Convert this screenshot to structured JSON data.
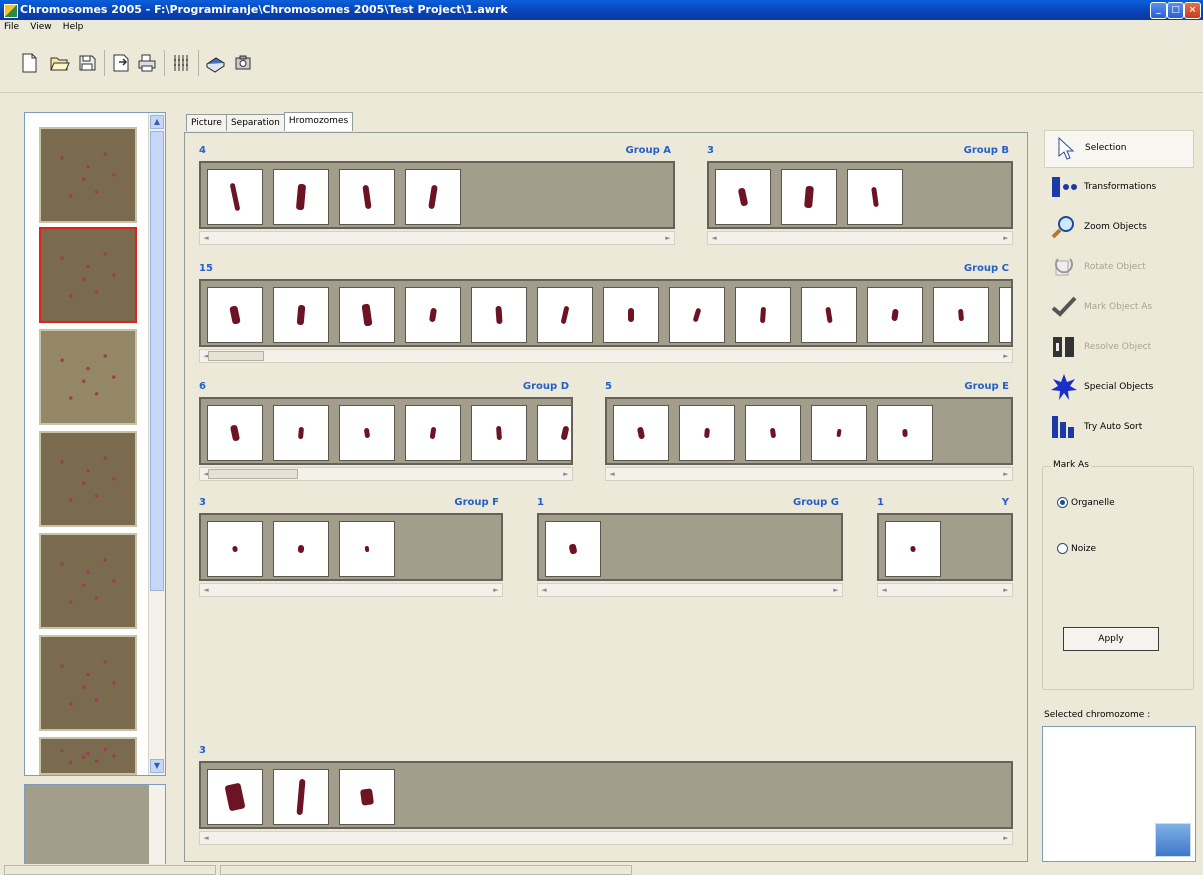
{
  "window": {
    "title": "Chromosomes 2005 - F:\\Programiranje\\Chromosomes 2005\\Test Project\\1.awrk"
  },
  "menu": [
    "File",
    "View",
    "Help"
  ],
  "toolbar": {
    "icons": [
      "new-document-icon",
      "open-folder-icon",
      "save-icon",
      "export-icon",
      "print-icon",
      "karyotype-icon",
      "book-icon",
      "camera-icon"
    ]
  },
  "tabs": [
    {
      "label": "Picture"
    },
    {
      "label": "Separation"
    },
    {
      "label": "Hromozomes"
    }
  ],
  "groups": [
    {
      "count": "4",
      "name": "Group A",
      "cells": 4
    },
    {
      "count": "3",
      "name": "Group B",
      "cells": 3
    },
    {
      "count": "15",
      "name": "Group C",
      "cells": 13
    },
    {
      "count": "6",
      "name": "Group D",
      "cells": 6
    },
    {
      "count": "5",
      "name": "Group E",
      "cells": 5
    },
    {
      "count": "3",
      "name": "Group F",
      "cells": 3
    },
    {
      "count": "1",
      "name": "Group G",
      "cells": 1
    },
    {
      "count": "1",
      "name": "Y",
      "cells": 1
    },
    {
      "count": "3",
      "name": "",
      "cells": 3
    }
  ],
  "tools": [
    {
      "label": "Selection",
      "icon": "cursor-icon",
      "enabled": true
    },
    {
      "label": "Transformations",
      "icon": "transform-icon",
      "enabled": true
    },
    {
      "label": "Zoom Objects",
      "icon": "magnifier-icon",
      "enabled": true
    },
    {
      "label": "Rotate Object",
      "icon": "rotate-icon",
      "enabled": false
    },
    {
      "label": "Mark Object As",
      "icon": "checkmark-icon",
      "enabled": false
    },
    {
      "label": "Resolve Object",
      "icon": "resolve-icon",
      "enabled": false
    },
    {
      "label": "Special Objects",
      "icon": "star-burst-icon",
      "enabled": true
    },
    {
      "label": "Try Auto Sort",
      "icon": "bar-sort-icon",
      "enabled": true
    }
  ],
  "mark_as": {
    "legend": "Mark As",
    "options": [
      {
        "label": "Organelle",
        "selected": true
      },
      {
        "label": "Noize",
        "selected": false
      }
    ],
    "apply_label": "Apply"
  },
  "selected_chromosome_label": "Selected chromozome :",
  "colors": {
    "accent": "#2560c8",
    "chromosome": "#6c1424",
    "selected_thumb_border": "#e2221a"
  }
}
